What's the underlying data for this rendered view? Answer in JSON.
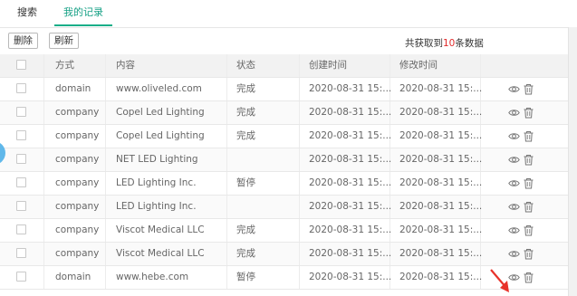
{
  "tabs": [
    {
      "label": "搜索",
      "active": false
    },
    {
      "label": "我的记录",
      "active": true
    }
  ],
  "toolbar": {
    "delete_label": "删除",
    "refresh_label": "刷新",
    "count_prefix": "共获取到",
    "count_value": "10",
    "count_suffix": "条数据"
  },
  "table": {
    "headers": {
      "type": "方式",
      "content": "内容",
      "status": "状态",
      "created": "创建时间",
      "modified": "修改时间"
    },
    "rows": [
      {
        "type": "domain",
        "content": "www.oliveled.com",
        "status": "完成",
        "created": "2020-08-31 15:...",
        "modified": "2020-08-31 15:..."
      },
      {
        "type": "company",
        "content": "Copel Led Lighting",
        "status": "完成",
        "created": "2020-08-31 15:...",
        "modified": "2020-08-31 15:..."
      },
      {
        "type": "company",
        "content": "Copel Led Lighting",
        "status": "完成",
        "created": "2020-08-31 15:...",
        "modified": "2020-08-31 15:..."
      },
      {
        "type": "company",
        "content": "NET LED Lighting",
        "status": "",
        "created": "2020-08-31 15:...",
        "modified": "2020-08-31 15:..."
      },
      {
        "type": "company",
        "content": "LED Lighting Inc.",
        "status": "暂停",
        "created": "2020-08-31 15:...",
        "modified": "2020-08-31 15:..."
      },
      {
        "type": "company",
        "content": "LED Lighting Inc.",
        "status": "",
        "created": "2020-08-31 15:...",
        "modified": "2020-08-31 15:..."
      },
      {
        "type": "company",
        "content": "Viscot Medical LLC",
        "status": "完成",
        "created": "2020-08-31 15:...",
        "modified": "2020-08-31 15:..."
      },
      {
        "type": "company",
        "content": "Viscot Medical LLC",
        "status": "完成",
        "created": "2020-08-31 15:...",
        "modified": "2020-08-31 15:..."
      },
      {
        "type": "domain",
        "content": "www.hebe.com",
        "status": "暂停",
        "created": "2020-08-31 15:...",
        "modified": "2020-08-31 15:..."
      }
    ]
  },
  "icons": {
    "view": "eye-icon",
    "delete": "trash-icon"
  },
  "colors": {
    "accent": "#1aae88",
    "count_highlight": "#e02a2a",
    "header_bg": "#f2f2f2",
    "annotation_arrow": "#e8322a"
  }
}
